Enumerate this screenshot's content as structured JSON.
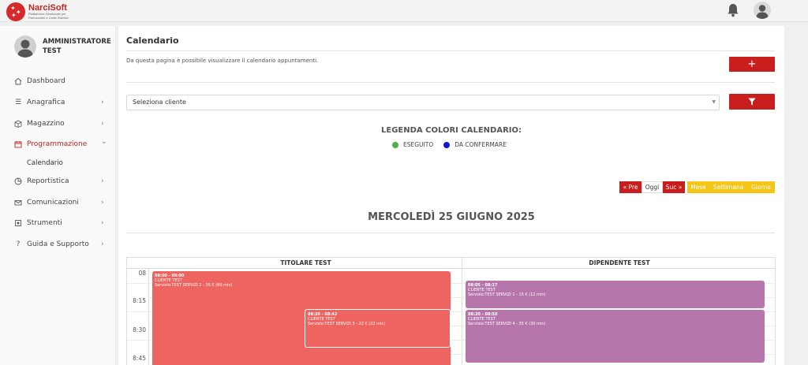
{
  "app": {
    "logo_title": "NarciSoft",
    "logo_subtitle": "Piattaforma Gestionale per Parrucchieri e Centri Estetici"
  },
  "user": {
    "name": "AMMINISTRATORE TEST"
  },
  "sidebar": {
    "items": [
      {
        "label": "Dashboard",
        "icon": "home-icon",
        "chevron": ""
      },
      {
        "label": "Anagrafica",
        "icon": "list-icon",
        "chevron": "›"
      },
      {
        "label": "Magazzino",
        "icon": "box-icon",
        "chevron": "›"
      },
      {
        "label": "Programmazione",
        "icon": "calendar-icon",
        "chevron": "⌄"
      },
      {
        "label": "Reportistica",
        "icon": "pie-chart-icon",
        "chevron": "›"
      },
      {
        "label": "Comunicazioni",
        "icon": "mail-icon",
        "chevron": "›"
      },
      {
        "label": "Strumenti",
        "icon": "tools-icon",
        "chevron": "›"
      },
      {
        "label": "Guida e Supporto",
        "icon": "question-icon",
        "chevron": "›"
      }
    ],
    "sub_item": "Calendario"
  },
  "main": {
    "title": "Calendario",
    "description": "Da questa pagina è possibile visualizzare il calendario appuntamenti.",
    "add_label": "+",
    "select_placeholder": "Seleziona cliente",
    "legend_title": "LEGENDA COLORI CALENDARIO:",
    "legend": [
      {
        "label": "ESEGUITO",
        "color": "#4caf50"
      },
      {
        "label": "DA CONFERMARE",
        "color": "#1515d6"
      }
    ],
    "nav_buttons": {
      "prev": "« Pre",
      "today": "Oggi",
      "next": "Suc »"
    },
    "view_buttons": {
      "month": "Mese",
      "week": "Settimana",
      "day": "Giorno"
    },
    "date_title": "MERCOLEDÌ 25 GIUGNO 2025"
  },
  "calendar": {
    "columns": [
      "TITOLARE TEST",
      "DIPENDENTE TEST"
    ],
    "times": [
      "08",
      "8:15",
      "8:30",
      "8:45"
    ],
    "events": [
      {
        "time": "08:00 - 09:00",
        "client": "CLIENTE TEST",
        "service": "Servizio:TEST SERVIZI 2 - 35 € (60 min)",
        "color": "#ee6461"
      },
      {
        "time": "08:20 - 08:42",
        "client": "CLIENTE TEST",
        "service": "Servizio:TEST SERVIZI 3 - 22 € (22 min)",
        "color": "#ee6461"
      },
      {
        "time": "08:05 - 08:17",
        "client": "CLIENTE TEST",
        "service": "Servizio:TEST SERVIZI 1 - 15 € (12 min)",
        "color": "#b776ab"
      },
      {
        "time": "08:20 - 08:50",
        "client": "CLIENTE TEST",
        "service": "Servizio:TEST SERVIZI 4 - 35 € (30 min)",
        "color": "#b776ab"
      }
    ]
  },
  "colors": {
    "brand_red": "#c81e1e",
    "view_yellow": "#f5c518"
  }
}
